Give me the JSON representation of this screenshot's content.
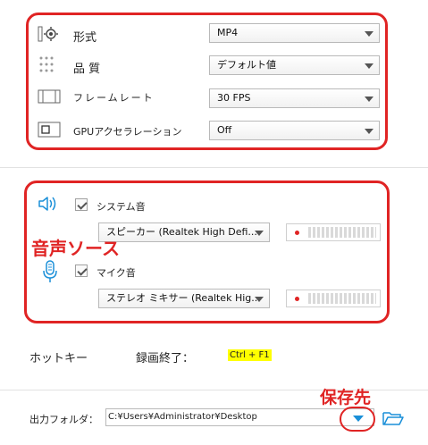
{
  "video_settings": {
    "format": {
      "label": "形式",
      "value": "MP4",
      "icon": "gear-icon"
    },
    "quality": {
      "label": "品 質",
      "value": "デフォルト値",
      "icon": "dots-icon"
    },
    "framerate": {
      "label": "フレームレート",
      "value": "30 FPS",
      "icon": "film-icon"
    },
    "gpu": {
      "label": "GPUアクセラレーション",
      "value": "Off",
      "icon": "chip-icon"
    }
  },
  "audio": {
    "annotation": "音声ソース",
    "system": {
      "label": "システム音",
      "checked": true,
      "device": "スピーカー (Realtek High Defi...",
      "icon": "speaker-icon"
    },
    "mic": {
      "label": "マイク音",
      "checked": true,
      "device": "ステレオ ミキサー (Realtek Hig...",
      "icon": "microphone-icon"
    }
  },
  "hotkey": {
    "label": "ホットキー",
    "action": "録画終了：",
    "key": "Ctrl + F1"
  },
  "output": {
    "label": "出力フォルダ：",
    "path": "C:¥Users¥Administrator¥Desktop",
    "annotation": "保存先"
  },
  "colors": {
    "annotation_red": "#e02424",
    "accent_blue": "#1a8fd8",
    "hotkey_highlight": "#ffff00"
  }
}
